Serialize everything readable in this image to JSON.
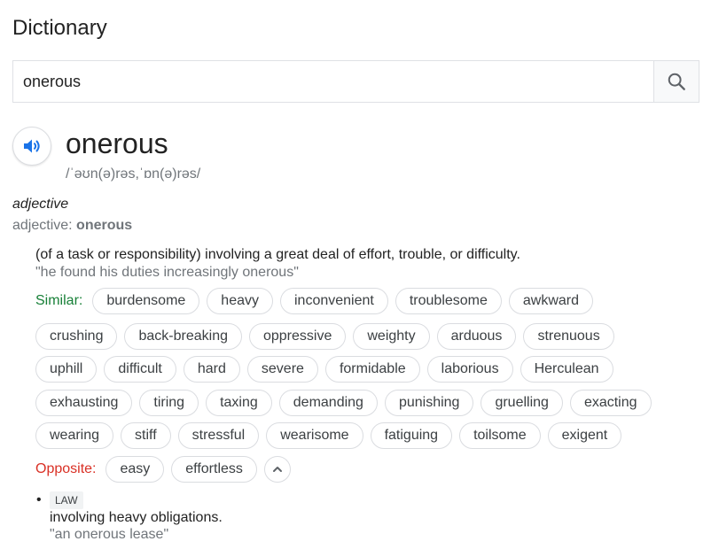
{
  "header": {
    "title": "Dictionary"
  },
  "search": {
    "value": "onerous"
  },
  "entry": {
    "word": "onerous",
    "phonetic": "/ˈəʊn(ə)rəs,ˈɒn(ə)rəs/",
    "pos_italic": "adjective",
    "pos_prefix": "adjective:",
    "pos_word": "onerous",
    "definition": "(of a task or responsibility) involving a great deal of effort, trouble, or difficulty.",
    "example": "\"he found his duties increasingly onerous\"",
    "similar_label": "Similar:",
    "synonym_rows": [
      [
        "burdensome",
        "heavy",
        "inconvenient",
        "troublesome",
        "awkward"
      ],
      [
        "crushing",
        "back-breaking",
        "oppressive",
        "weighty",
        "arduous",
        "strenuous"
      ],
      [
        "uphill",
        "difficult",
        "hard",
        "severe",
        "formidable",
        "laborious",
        "Herculean"
      ],
      [
        "exhausting",
        "tiring",
        "taxing",
        "demanding",
        "punishing",
        "gruelling",
        "exacting"
      ],
      [
        "wearing",
        "stiff",
        "stressful",
        "wearisome",
        "fatiguing",
        "toilsome",
        "exigent"
      ]
    ],
    "opposite_label": "Opposite:",
    "antonyms": [
      "easy",
      "effortless"
    ],
    "sense": {
      "bullet": "•",
      "tag": "LAW",
      "definition": "involving heavy obligations.",
      "example": "\"an onerous lease\""
    }
  },
  "colors": {
    "similar": "#188038",
    "opposite": "#d93025",
    "speaker_icon": "#1a73e8"
  },
  "icons": {
    "search": "search-icon",
    "speaker": "speaker-icon",
    "collapse": "chevron-up-icon"
  }
}
